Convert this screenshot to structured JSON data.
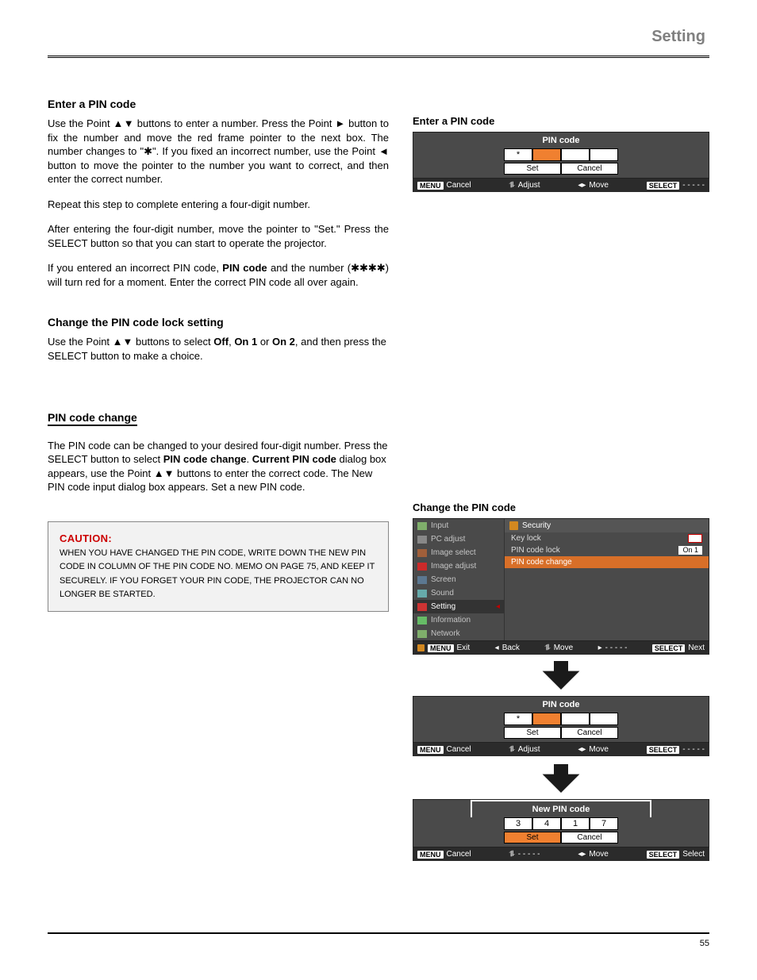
{
  "page": {
    "header_right": "Setting",
    "number": "55",
    "footer": ""
  },
  "sec1": {
    "title": "Enter a PIN code",
    "p1a": "Use the Point ▲▼ buttons to enter a number. Press the Point ► button to fix the number and move the red frame pointer to the next box. The number changes to \"",
    "ast": "✱",
    "p1b": "\". If you fixed an incorrect number, use the Point ◄ button to move the pointer to the number you want to correct, and then enter the correct number.",
    "p2": "Repeat this step to complete entering a four-digit number.",
    "p3": "After entering the four-digit number, move the pointer to \"Set.\" Press the SELECT button so that you can start to operate the projector.",
    "p4a": "If you entered an incorrect PIN code, ",
    "p4_pin": "PIN code",
    "p4b": " and the number (",
    "p4_ast": "✱✱✱✱",
    "p4c": ") will turn red for a moment. Enter the correct PIN code all over again."
  },
  "sec2": {
    "title": "Change the PIN code lock setting",
    "p1a": "Use the Point ▲▼ buttons to select ",
    "off": "Off",
    "p1b": ", ",
    "on1": "On 1",
    "p1c": " or ",
    "on2": "On 2",
    "p1d": ", and then press the SELECT button to make a choice."
  },
  "sec3": {
    "title": "PIN code change",
    "p1a": "The PIN code can be changed to your desired four-digit number. Press the SELECT button to select ",
    "pcc": "PIN code change",
    "p1b": ". ",
    "cpc": "Current PIN code",
    "p1c": " dialog box appears, use the Point ▲▼ buttons to enter the correct code. The New PIN code input dialog box appears. Set a new PIN code."
  },
  "caution": {
    "title": "CAUTION:",
    "l1a": "WHEN YOU HAVE CHANGED THE PIN CODE, WRITE DOWN THE NEW PIN CODE IN COLUMN OF THE PIN CODE NO. MEMO ON PAGE 75, AND KEEP IT SECURELY. IF YOU FORGET YOUR PIN CODE, THE PROJECTOR CAN NO LONGER BE STARTED."
  },
  "right": {
    "label1": "Enter a PIN code",
    "label2": "Change the PIN code"
  },
  "pin": {
    "title": "PIN code",
    "newtitle": "New PIN code",
    "star": "*",
    "set": "Set",
    "cancel": "Cancel",
    "d3": "3",
    "d4": "4",
    "d1": "1",
    "d7": "7"
  },
  "footerbar": {
    "menu": "MENU",
    "cancel": "Cancel",
    "adjust": "Adjust",
    "move": "Move",
    "select_badge": "SELECT",
    "dashes": "- - - - -",
    "select": "Select",
    "exit": "Exit",
    "back": "Back",
    "next": "Next"
  },
  "menu": {
    "items": [
      "Input",
      "PC adjust",
      "Image select",
      "Image adjust",
      "Screen",
      "Sound",
      "Setting",
      "Information",
      "Network"
    ],
    "security": "Security",
    "keylock": "Key lock",
    "pincodelock": "PIN code lock",
    "on1": "On 1",
    "pincodechange": "PIN code change"
  }
}
